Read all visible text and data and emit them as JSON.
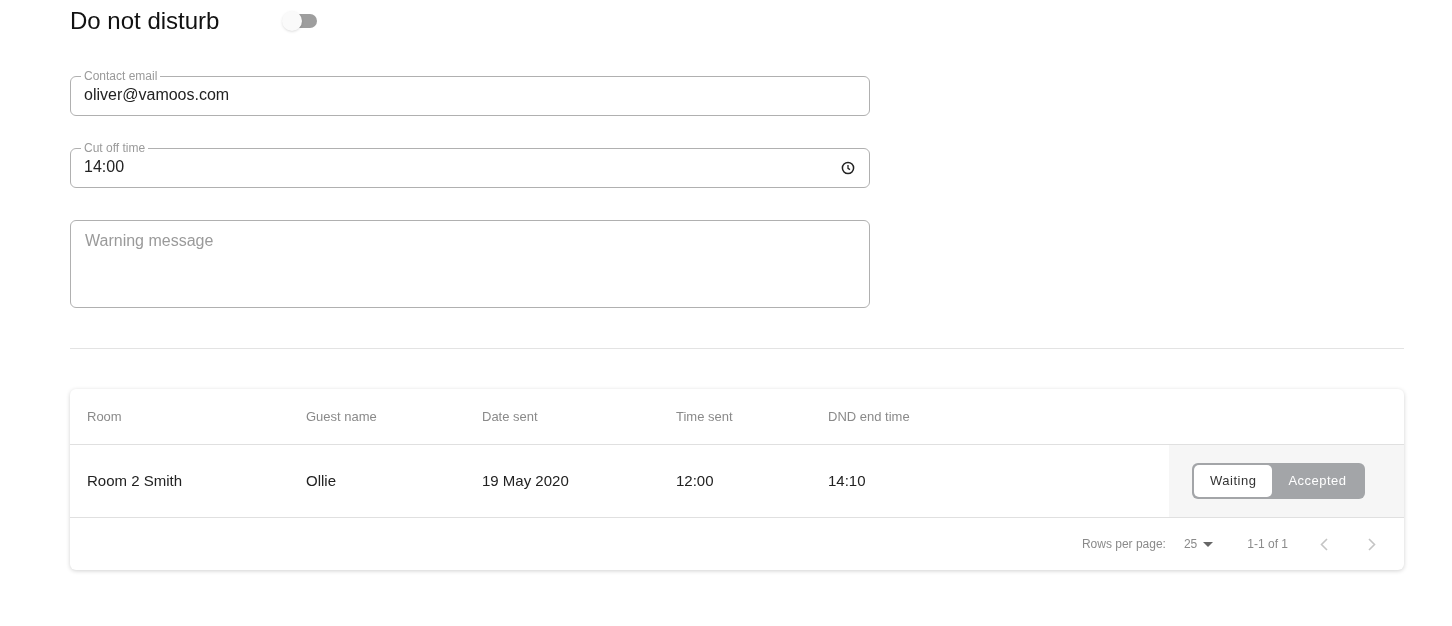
{
  "title": "Do not disturb",
  "dnd_toggle": {
    "on": false
  },
  "fields": [
    {
      "kind": "text",
      "label": "Contact email",
      "value": "oliver@vamoos.com"
    },
    {
      "kind": "time",
      "label": "Cut off time",
      "value": "14:00"
    },
    {
      "kind": "textarea",
      "placeholder": "Warning message"
    }
  ],
  "table": {
    "columns": [
      "Room",
      "Guest name",
      "Date sent",
      "Time sent",
      "DND end time"
    ],
    "rows": [
      {
        "cells": [
          "Room 2 Smith",
          "Ollie",
          "19 May 2020",
          "12:00",
          "14:10"
        ],
        "status_options": [
          {
            "label": "Waiting",
            "selected": true
          },
          {
            "label": "Accepted",
            "selected": false
          }
        ]
      }
    ],
    "pagination": {
      "rows_per_page_label": "Rows per page:",
      "rows_per_page": "25",
      "range": "1-1 of 1"
    }
  }
}
